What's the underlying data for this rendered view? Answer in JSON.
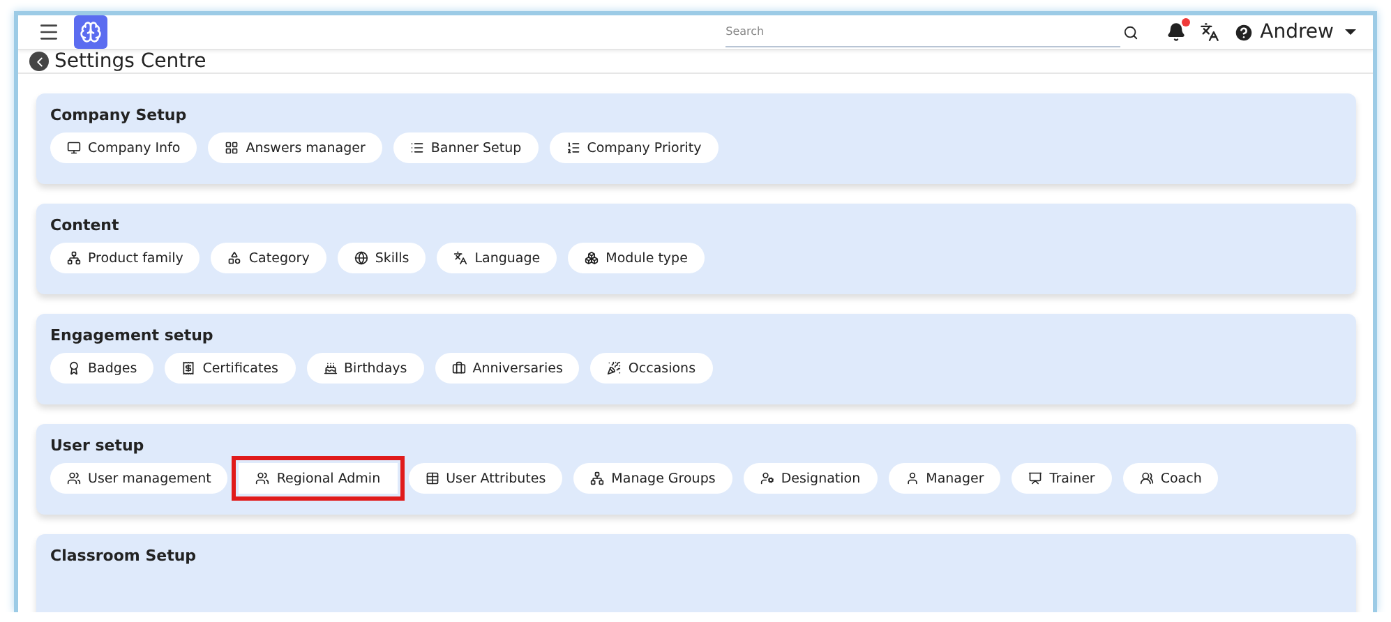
{
  "header": {
    "search": {
      "placeholder": "Search"
    },
    "notifications": {
      "unread": true
    },
    "user": {
      "name": "Andrew"
    }
  },
  "page": {
    "title": "Settings Centre"
  },
  "sections": [
    {
      "title": "Company Setup",
      "items": [
        {
          "label": "Company Info",
          "highlighted": false
        },
        {
          "label": "Answers manager",
          "highlighted": false
        },
        {
          "label": "Banner Setup",
          "highlighted": false
        },
        {
          "label": "Company Priority",
          "highlighted": false
        }
      ]
    },
    {
      "title": "Content",
      "items": [
        {
          "label": "Product family",
          "highlighted": false
        },
        {
          "label": "Category",
          "highlighted": false
        },
        {
          "label": "Skills",
          "highlighted": false
        },
        {
          "label": "Language",
          "highlighted": false
        },
        {
          "label": "Module type",
          "highlighted": false
        }
      ]
    },
    {
      "title": "Engagement setup",
      "items": [
        {
          "label": "Badges",
          "highlighted": false
        },
        {
          "label": "Certificates",
          "highlighted": false
        },
        {
          "label": "Birthdays",
          "highlighted": false
        },
        {
          "label": "Anniversaries",
          "highlighted": false
        },
        {
          "label": "Occasions",
          "highlighted": false
        }
      ]
    },
    {
      "title": "User setup",
      "items": [
        {
          "label": "User management",
          "highlighted": false
        },
        {
          "label": "Regional Admin",
          "highlighted": true
        },
        {
          "label": "User Attributes",
          "highlighted": false
        },
        {
          "label": "Manage Groups",
          "highlighted": false
        },
        {
          "label": "Designation",
          "highlighted": false
        },
        {
          "label": "Manager",
          "highlighted": false
        },
        {
          "label": "Trainer",
          "highlighted": false
        },
        {
          "label": "Coach",
          "highlighted": false
        }
      ]
    },
    {
      "title": "Classroom Setup"
    }
  ]
}
